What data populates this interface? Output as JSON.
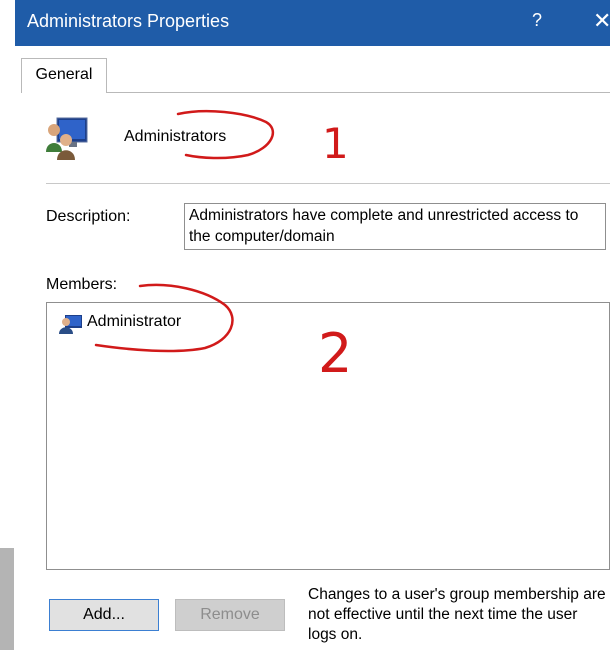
{
  "window": {
    "title": "Administrators Properties",
    "help_label": "?",
    "close_label": "✕"
  },
  "tabs": [
    {
      "label": "General"
    }
  ],
  "group": {
    "name": "Administrators",
    "icon": "group-users-icon"
  },
  "description": {
    "label": "Description:",
    "value": "Administrators have complete and unrestricted access to the computer/domain"
  },
  "members": {
    "label": "Members:",
    "items": [
      {
        "label": "Administrator",
        "icon": "user-icon"
      }
    ]
  },
  "buttons": {
    "add": "Add...",
    "remove": "Remove"
  },
  "note": "Changes to a user's group membership are not effective until the next time the user logs on.",
  "annotations": {
    "first": "1",
    "second": "2"
  },
  "colors": {
    "titlebar": "#1f5ca8",
    "annotation_ink": "#d11a1a"
  }
}
